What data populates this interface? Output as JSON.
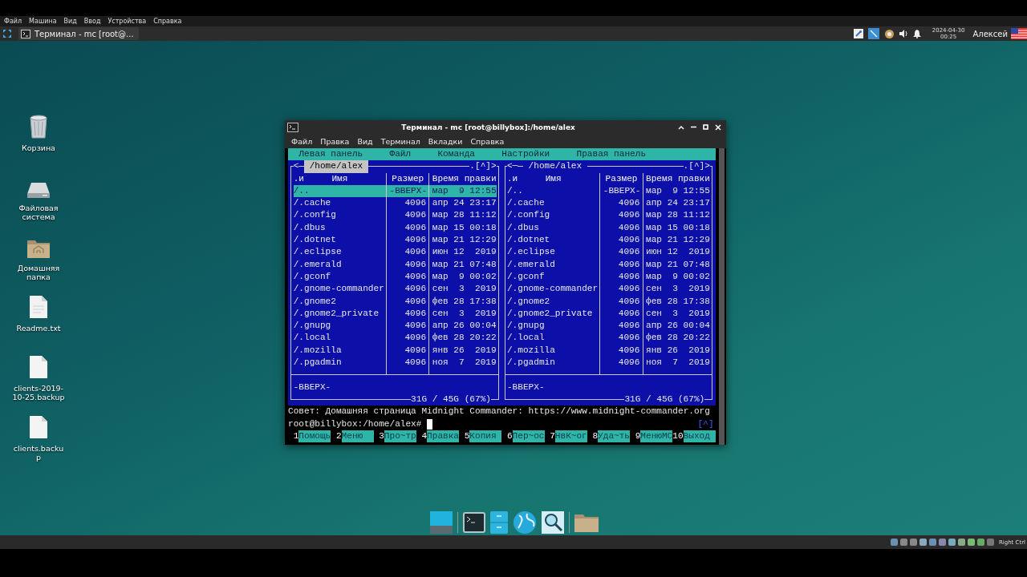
{
  "host_menu": [
    "Файл",
    "Машина",
    "Вид",
    "Ввод",
    "Устройства",
    "Справка"
  ],
  "top_panel": {
    "task": "Терминал - mc [root@...",
    "date": "2024-04-30",
    "time": "00:25",
    "user": "Алексей"
  },
  "desktop_icons": [
    {
      "kind": "trash",
      "label": "Корзина"
    },
    {
      "kind": "drive",
      "label": "Файловая система"
    },
    {
      "kind": "home",
      "label": "Домашняя папка"
    },
    {
      "kind": "text",
      "label": "Readme.txt"
    },
    {
      "kind": "file",
      "label": "clients-2019-10-25.backup"
    },
    {
      "kind": "file",
      "label": "clients.backup"
    }
  ],
  "terminal": {
    "title": "Терминал - mc [root@billybox]:/home/alex",
    "menu": [
      "Файл",
      "Правка",
      "Вид",
      "Терминал",
      "Вкладки",
      "Справка"
    ],
    "mc": {
      "menu": [
        "Левая панель",
        "Файл",
        "Команда",
        "Настройки",
        "Правая панель"
      ],
      "panels": [
        {
          "active": true,
          "left_mark": "<",
          "path": "/home/alex",
          "right_mark": ".[^]>",
          "sort_mark": ".и",
          "columns": [
            "Имя",
            "Размер",
            "Время правки"
          ],
          "status": "-ВВЕРХ-",
          "disk": "31G / 45G (67%)",
          "files": [
            {
              "name": "/..",
              "size": "-ВВЕРХ-",
              "time": "мар  9 12:55",
              "selected": true
            },
            {
              "name": "/.cache",
              "size": "4096",
              "time": "апр 24 23:17",
              "selected": false
            },
            {
              "name": "/.config",
              "size": "4096",
              "time": "мар 28 11:12",
              "selected": false
            },
            {
              "name": "/.dbus",
              "size": "4096",
              "time": "мар 15 00:18",
              "selected": false
            },
            {
              "name": "/.dotnet",
              "size": "4096",
              "time": "мар 21 12:29",
              "selected": false
            },
            {
              "name": "/.eclipse",
              "size": "4096",
              "time": "июн 12  2019",
              "selected": false
            },
            {
              "name": "/.emerald",
              "size": "4096",
              "time": "мар 21 07:48",
              "selected": false
            },
            {
              "name": "/.gconf",
              "size": "4096",
              "time": "мар  9 00:02",
              "selected": false
            },
            {
              "name": "/.gnome-commander",
              "size": "4096",
              "time": "сен  3  2019",
              "selected": false
            },
            {
              "name": "/.gnome2",
              "size": "4096",
              "time": "фев 28 17:38",
              "selected": false
            },
            {
              "name": "/.gnome2_private",
              "size": "4096",
              "time": "сен  3  2019",
              "selected": false
            },
            {
              "name": "/.gnupg",
              "size": "4096",
              "time": "апр 26 00:04",
              "selected": false
            },
            {
              "name": "/.local",
              "size": "4096",
              "time": "фев 28 20:22",
              "selected": false
            },
            {
              "name": "/.mozilla",
              "size": "4096",
              "time": "янв 26  2019",
              "selected": false
            },
            {
              "name": "/.pgadmin",
              "size": "4096",
              "time": "ноя  7  2019",
              "selected": false
            }
          ]
        },
        {
          "active": false,
          "left_mark": "<─",
          "path": "/home/alex",
          "right_mark": ".[^]>",
          "sort_mark": ".и",
          "columns": [
            "Имя",
            "Размер",
            "Время правки"
          ],
          "status": "-ВВЕРХ-",
          "disk": "31G / 45G (67%)",
          "files": [
            {
              "name": "/..",
              "size": "-ВВЕРХ-",
              "time": "мар  9 12:55",
              "selected": false
            },
            {
              "name": "/.cache",
              "size": "4096",
              "time": "апр 24 23:17",
              "selected": false
            },
            {
              "name": "/.config",
              "size": "4096",
              "time": "мар 28 11:12",
              "selected": false
            },
            {
              "name": "/.dbus",
              "size": "4096",
              "time": "мар 15 00:18",
              "selected": false
            },
            {
              "name": "/.dotnet",
              "size": "4096",
              "time": "мар 21 12:29",
              "selected": false
            },
            {
              "name": "/.eclipse",
              "size": "4096",
              "time": "июн 12  2019",
              "selected": false
            },
            {
              "name": "/.emerald",
              "size": "4096",
              "time": "мар 21 07:48",
              "selected": false
            },
            {
              "name": "/.gconf",
              "size": "4096",
              "time": "мар  9 00:02",
              "selected": false
            },
            {
              "name": "/.gnome-commander",
              "size": "4096",
              "time": "сен  3  2019",
              "selected": false
            },
            {
              "name": "/.gnome2",
              "size": "4096",
              "time": "фев 28 17:38",
              "selected": false
            },
            {
              "name": "/.gnome2_private",
              "size": "4096",
              "time": "сен  3  2019",
              "selected": false
            },
            {
              "name": "/.gnupg",
              "size": "4096",
              "time": "апр 26 00:04",
              "selected": false
            },
            {
              "name": "/.local",
              "size": "4096",
              "time": "фев 28 20:22",
              "selected": false
            },
            {
              "name": "/.mozilla",
              "size": "4096",
              "time": "янв 26  2019",
              "selected": false
            },
            {
              "name": "/.pgadmin",
              "size": "4096",
              "time": "ноя  7  2019",
              "selected": false
            }
          ]
        }
      ],
      "hint": "Совет: Домашняя страница Midnight Commander: https://www.midnight-commander.org",
      "prompt": "root@billybox:/home/alex#",
      "history": "[^]",
      "keys": [
        {
          "number": "1",
          "label": "Помощь"
        },
        {
          "number": "2",
          "label": "Меню"
        },
        {
          "number": "3",
          "label": "Про~тр"
        },
        {
          "number": "4",
          "label": "Правка"
        },
        {
          "number": "5",
          "label": "Копия"
        },
        {
          "number": "6",
          "label": "Пер~ос"
        },
        {
          "number": "7",
          "label": "НвК~ог"
        },
        {
          "number": "8",
          "label": "Уда~ть"
        },
        {
          "number": "9",
          "label": "МенюМС"
        },
        {
          "number": "10",
          "label": "Выход"
        }
      ]
    }
  },
  "status_bar": {
    "host_key": "Right Ctrl"
  }
}
